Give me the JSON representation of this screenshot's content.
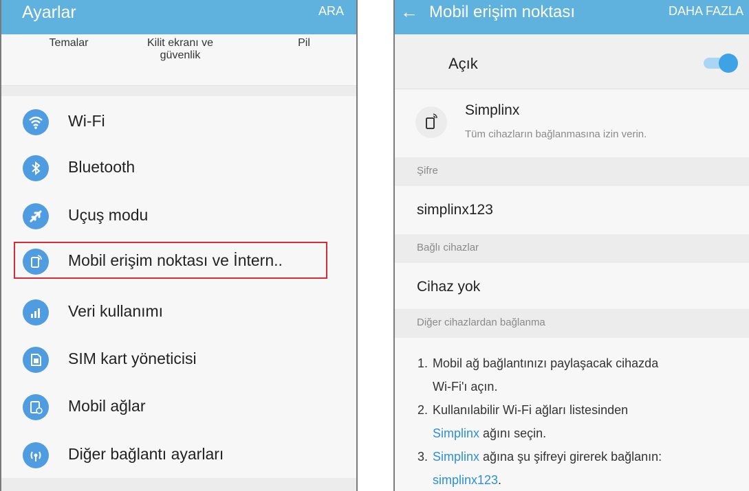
{
  "left": {
    "header": {
      "title": "Ayarlar",
      "action": "ARA"
    },
    "shortcuts": [
      {
        "label": "Temalar"
      },
      {
        "label": "Kilit ekranı ve güvenlik"
      },
      {
        "label": "Pil"
      }
    ],
    "items": [
      {
        "label": "Wi-Fi",
        "icon": "wifi-icon"
      },
      {
        "label": "Bluetooth",
        "icon": "bluetooth-icon"
      },
      {
        "label": "Uçuş modu",
        "icon": "airplane-icon"
      },
      {
        "label": "Mobil erişim noktası ve İntern..",
        "icon": "hotspot-icon",
        "highlighted": true
      },
      {
        "label": "Veri kullanımı",
        "icon": "data-usage-icon"
      },
      {
        "label": "SIM kart yöneticisi",
        "icon": "sim-card-icon"
      },
      {
        "label": "Mobil ağlar",
        "icon": "mobile-network-icon"
      },
      {
        "label": "Diğer bağlantı ayarları",
        "icon": "connection-settings-icon"
      }
    ],
    "colors": {
      "accent": "#5eb2dd",
      "icon": "#4f9de0",
      "highlight": "#d62b34"
    }
  },
  "right": {
    "header": {
      "title": "Mobil erişim noktası",
      "action": "DAHA FAZLA"
    },
    "toggle": {
      "label": "Açık",
      "on": true
    },
    "network": {
      "name": "Simplinx",
      "subtitle": "Tüm cihazların bağlanmasına izin verin."
    },
    "password": {
      "header": "Şifre",
      "value": "simplinx123"
    },
    "devices": {
      "header": "Bağlı cihazlar",
      "value": "Cihaz yok"
    },
    "other": {
      "header": "Diğer cihazlardan bağlanma",
      "step1_num": "1.",
      "step1_line1": "Mobil ağ bağlantınızı paylaşacak cihazda",
      "step1_line2": "Wi-Fi'ı açın.",
      "step2_num": "2.",
      "step2_line1": "Kullanılabilir Wi-Fi ağları listesinden",
      "step2_link": "Simplinx",
      "step2_rest": " ağını seçin.",
      "step3_num": "3.",
      "step3_link": "Simplinx",
      "step3_rest": " ağına şu şifreyi girerek bağlanın:",
      "step3_link2": "simplinx123",
      "step3_end": "."
    },
    "colors": {
      "link": "#2c8fd7",
      "toggle": "#3ea3e5"
    }
  }
}
